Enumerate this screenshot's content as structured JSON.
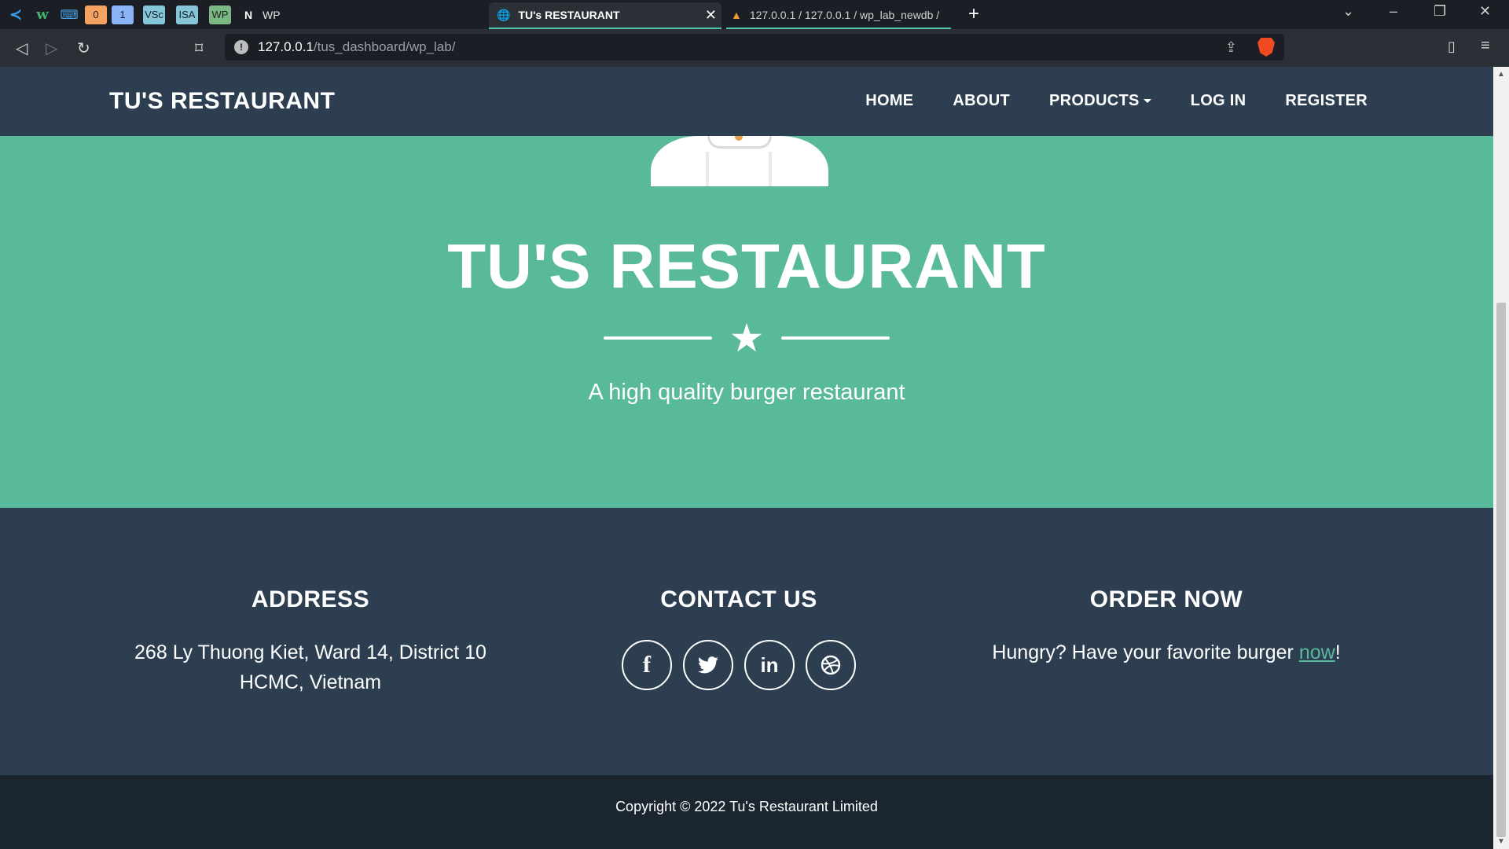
{
  "browser": {
    "pinned_tabs": [
      "0",
      "1",
      "VSc",
      "ISA",
      "WP"
    ],
    "notion_tab_label": "WP",
    "active_tab_title": "TU's RESTAURANT",
    "second_tab_title": "127.0.0.1 / 127.0.0.1 / wp_lab_newdb /",
    "url_host": "127.0.0.1",
    "url_path": "/tus_dashboard/wp_lab/"
  },
  "navbar": {
    "brand": "TU'S RESTAURANT",
    "links": [
      "HOME",
      "ABOUT",
      "PRODUCTS",
      "LOG IN",
      "REGISTER"
    ]
  },
  "masthead": {
    "title": "TU'S RESTAURANT",
    "subtitle": "A high quality burger restaurant"
  },
  "footer": {
    "address": {
      "heading": "ADDRESS",
      "line1": "268 Ly Thuong Kiet, Ward 14, District 10",
      "line2": "HCMC, Vietnam"
    },
    "contact": {
      "heading": "CONTACT US",
      "socials": [
        "facebook-icon",
        "twitter-icon",
        "linkedin-icon",
        "dribbble-icon"
      ],
      "linkedin_text": "in"
    },
    "order": {
      "heading": "ORDER NOW",
      "text_before": "Hungry? Have your favorite burger ",
      "link": "now",
      "text_after": "!"
    }
  },
  "copyright": "Copyright © 2022 Tu's Restaurant Limited",
  "colors": {
    "primary": "#2c3e50",
    "accent": "#59b99b",
    "copyright_bg": "#1a252f"
  }
}
